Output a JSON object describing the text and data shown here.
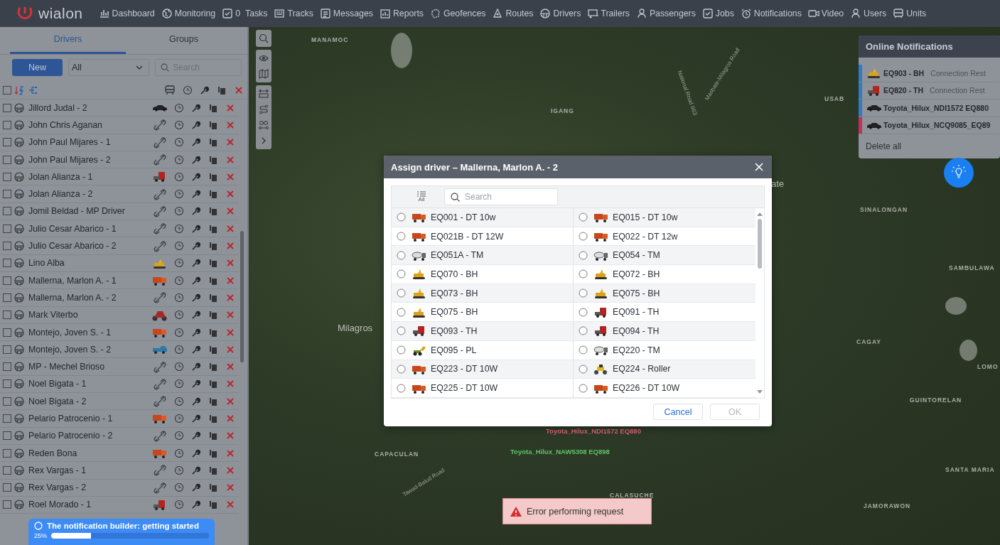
{
  "navbar": {
    "logo": "wialon",
    "items": [
      {
        "label": "Dashboard"
      },
      {
        "label": "Monitoring"
      },
      {
        "label": "Tasks",
        "count": "0"
      },
      {
        "label": "Tracks"
      },
      {
        "label": "Messages"
      },
      {
        "label": "Reports"
      },
      {
        "label": "Geofences"
      },
      {
        "label": "Routes"
      },
      {
        "label": "Drivers"
      },
      {
        "label": "Trailers"
      },
      {
        "label": "Passengers"
      },
      {
        "label": "Jobs"
      },
      {
        "label": "Notifications"
      },
      {
        "label": "Video"
      },
      {
        "label": "Users"
      },
      {
        "label": "Units"
      }
    ]
  },
  "sidebar": {
    "tabs": [
      {
        "label": "Drivers",
        "selected": true
      },
      {
        "label": "Groups",
        "selected": false
      }
    ],
    "new_button": "New",
    "filter": {
      "value": "All"
    },
    "search": {
      "placeholder": "Search"
    },
    "select_all_checked": false,
    "drivers": [
      {
        "name": "Jillord Judal - 2",
        "kind": "car",
        "checked": false
      },
      {
        "name": "John Chris Aganan",
        "kind": "link",
        "checked": false
      },
      {
        "name": "John Paul Mijares - 1",
        "kind": "link",
        "checked": false
      },
      {
        "name": "John Paul Mijares - 2",
        "kind": "link",
        "checked": false
      },
      {
        "name": "Jolan Alianza - 1",
        "kind": "tractor",
        "checked": false
      },
      {
        "name": "Jolan Alianza - 2",
        "kind": "link",
        "checked": false
      },
      {
        "name": "Jomil Beldad - MP Driver",
        "kind": "link",
        "checked": false
      },
      {
        "name": "Julio Cesar Abarico - 1",
        "kind": "link",
        "checked": false
      },
      {
        "name": "Julio Cesar Abarico - 2",
        "kind": "link",
        "checked": false
      },
      {
        "name": "Lino Alba",
        "kind": "backhoe",
        "checked": false
      },
      {
        "name": "Mallerna, Marlon A. - 1",
        "kind": "dump",
        "checked": false
      },
      {
        "name": "Mallerna, Marlon A. - 2",
        "kind": "link",
        "checked": false
      },
      {
        "name": "Mark Viterbo",
        "kind": "moto",
        "checked": false
      },
      {
        "name": "Montejo, Joven S. - 1",
        "kind": "dump",
        "checked": false
      },
      {
        "name": "Montejo, Joven S. - 2",
        "kind": "pickup",
        "checked": false
      },
      {
        "name": "MP - Mechel Brioso",
        "kind": "link",
        "checked": false
      },
      {
        "name": "Noel Bigata - 1",
        "kind": "link",
        "checked": false
      },
      {
        "name": "Noel Bigata - 2",
        "kind": "link",
        "checked": false
      },
      {
        "name": "Pelario Patrocenio - 1",
        "kind": "dump",
        "checked": false
      },
      {
        "name": "Pelario Patrocenio - 2",
        "kind": "link",
        "checked": false
      },
      {
        "name": "Reden Bona",
        "kind": "dump",
        "checked": false
      },
      {
        "name": "Rex Vargas - 1",
        "kind": "link",
        "checked": false
      },
      {
        "name": "Rex Vargas - 2",
        "kind": "link",
        "checked": false
      },
      {
        "name": "Roel Morado - 1",
        "kind": "tractor",
        "checked": false
      }
    ]
  },
  "map": {
    "labels": [
      {
        "text": "MANAMOC",
        "kind": "place"
      },
      {
        "text": "IGANG",
        "kind": "place"
      },
      {
        "text": "National Road 663",
        "kind": "road"
      },
      {
        "text": "Masbate-Milagros Road",
        "kind": "road"
      },
      {
        "text": "USAB",
        "kind": "place"
      },
      {
        "text": "ate",
        "kind": "town"
      },
      {
        "text": "SINALONGAN",
        "kind": "place"
      },
      {
        "text": "SAMBULAWA",
        "kind": "place"
      },
      {
        "text": "Milagros",
        "kind": "town"
      },
      {
        "text": "CAGAY",
        "kind": "place"
      },
      {
        "text": "LOMO",
        "kind": "place"
      },
      {
        "text": "GUINTORELAN",
        "kind": "place"
      },
      {
        "text": "SANTA MARIA",
        "kind": "place"
      },
      {
        "text": "CAPACULAN",
        "kind": "place"
      },
      {
        "text": "Tawad-Balud Road",
        "kind": "road"
      },
      {
        "text": "CALASUCHE",
        "kind": "place"
      },
      {
        "text": "JAMORAWON",
        "kind": "place"
      }
    ],
    "units": [
      {
        "text": "Toyota_Hilux_NDI1572 EQ880",
        "color": "#e0607a"
      },
      {
        "text": "Toyota_Hilux_NAW5308 EQ898",
        "color": "#5fc46a"
      }
    ]
  },
  "notifications": {
    "title": "Online Notifications",
    "items": [
      {
        "kind": "backhoe",
        "name": "EQ903 - BH",
        "message": "Connection Rest",
        "color": "#2f7cc4"
      },
      {
        "kind": "tractor",
        "name": "EQ820 - TH",
        "message": "Connection Rest",
        "color": "#2f7cc4"
      },
      {
        "kind": "car",
        "name": "Toyota_Hilux_NDI1572 EQ880",
        "color": "#2f7cc4"
      },
      {
        "kind": "car",
        "name": "Toyota_Hilux_NCQ9085_EQ89",
        "color": "#c2305e"
      }
    ],
    "delete_all": "Delete all"
  },
  "dialog": {
    "title": "Assign driver – Mallerna, Marlon A. - 2",
    "filter_label": "All",
    "search": {
      "placeholder": "Search"
    },
    "units": [
      {
        "name": "EQ001 - DT 10w",
        "kind": "dump",
        "selected": false
      },
      {
        "name": "EQ015 - DT 10w",
        "kind": "dump",
        "selected": false
      },
      {
        "name": "EQ021B - DT 12W",
        "kind": "dump",
        "selected": false
      },
      {
        "name": "EQ022 - DT 12w",
        "kind": "dump",
        "selected": false
      },
      {
        "name": "EQ051A - TM",
        "kind": "mixer",
        "selected": false
      },
      {
        "name": "EQ054 - TM",
        "kind": "mixer",
        "selected": false
      },
      {
        "name": "EQ070 - BH",
        "kind": "backhoe",
        "selected": false
      },
      {
        "name": "EQ072 - BH",
        "kind": "backhoe",
        "selected": false
      },
      {
        "name": "EQ073 - BH",
        "kind": "backhoe",
        "selected": false
      },
      {
        "name": "EQ075 - BH",
        "kind": "backhoe",
        "selected": false
      },
      {
        "name": "EQ075 - BH",
        "kind": "backhoe",
        "selected": false
      },
      {
        "name": "EQ091 - TH",
        "kind": "tractor",
        "selected": false
      },
      {
        "name": "EQ093 - TH",
        "kind": "tractor",
        "selected": false
      },
      {
        "name": "EQ094 - TH",
        "kind": "tractor",
        "selected": false
      },
      {
        "name": "EQ095 - PL",
        "kind": "loader",
        "selected": false
      },
      {
        "name": "EQ220 - TM",
        "kind": "mixer",
        "selected": false
      },
      {
        "name": "EQ223 - DT 10W",
        "kind": "dump",
        "selected": false
      },
      {
        "name": "EQ224 - Roller",
        "kind": "roller",
        "selected": false
      },
      {
        "name": "EQ225 - DT 10W",
        "kind": "dump",
        "selected": false
      },
      {
        "name": "EQ226 - DT 10W",
        "kind": "dump",
        "selected": false
      }
    ],
    "buttons": [
      {
        "label": "Cancel",
        "disabled": false
      },
      {
        "label": "OK",
        "disabled": true
      }
    ]
  },
  "error_toast": "Error performing request",
  "onboarding": {
    "title": "The notification builder: getting started",
    "percent": "25%",
    "level": 0.25
  }
}
